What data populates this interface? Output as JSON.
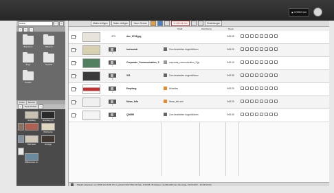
{
  "header": {
    "preview_label": "VORSCHAU"
  },
  "sidebar": {
    "search_value": "Global",
    "folders": [
      {
        "label": "Branchen"
      },
      {
        "label": "Dänisch"
      },
      {
        "label": "Engl."
      },
      {
        "label": "Technik"
      },
      {
        "label": "Kreativ"
      }
    ],
    "tabs": [
      "Listen",
      "Bereich"
    ],
    "media_search_label": "Neue Ordner",
    "thumbs": [
      {
        "label": "Empfang",
        "color": "#c8c0b0"
      },
      {
        "label": "Empfang (1)",
        "color": "#2a2a2a"
      },
      {
        "label": "",
        "color": "#8a7060"
      },
      {
        "label": "Wahlweise",
        "color": "#e0d8c0"
      },
      {
        "label": "",
        "color": "#b06050"
      },
      {
        "label": "",
        "color": "#8090a0"
      },
      {
        "label": "Bild Seite",
        "color": "#d0c8b8"
      },
      {
        "label": "Anzeige",
        "color": "#403830"
      },
      {
        "label": "",
        "color": "#e8e8e8"
      },
      {
        "label": "Willkommen im Haus",
        "color": "#6a8aa0"
      }
    ]
  },
  "toolbar": {
    "insert_media": "Media einfügen",
    "insert_data": "Daten einfügen",
    "new_screen": "Neuer Screen",
    "publish": "Veröffentlichen",
    "settings": "Einstellungen"
  },
  "columns": {
    "inhalt": "Inhalt",
    "zuordnung": "Zuordnung",
    "dauer": "Dauer"
  },
  "rows": [
    {
      "num": "1",
      "typ": "JPG",
      "size": "1",
      "name": "doc_6748.jpg",
      "inhalt": "",
      "dauer": "0:00:05",
      "thumb": "#e8e4dc",
      "inhalt_icon": "none"
    },
    {
      "num": "2",
      "typ": "",
      "size": "1",
      "name": "horizontal",
      "inhalt": "Zum bearbeiten doppelklicken",
      "dauer": "0:00:20",
      "thumb": "#d8d0b0",
      "inhalt_icon": "dark"
    },
    {
      "num": "3",
      "typ": "",
      "size": "1",
      "name": "Corporate_Communication_3",
      "inhalt": "corporate_communication_3.jpg",
      "dauer": "0:00:10",
      "thumb": "#508060",
      "inhalt_icon": "dark"
    },
    {
      "num": "4",
      "typ": "",
      "size": "1",
      "name": "321",
      "inhalt": "Zum bearbeiten doppelklicken",
      "dauer": "0:00:30",
      "thumb": "#3a3a3a",
      "inhalt_icon": "dark"
    },
    {
      "num": "5",
      "typ": "",
      "size": "1",
      "name": "Empfang",
      "inhalt": "Aktuelles",
      "dauer": "0:00:20",
      "thumb": "#c03030",
      "inhalt_icon": "orange"
    },
    {
      "num": "6",
      "typ": "",
      "size": "1",
      "name": "News_Info",
      "inhalt": "News_info.xml",
      "dauer": "0:00:20",
      "thumb": "#f0f0f0",
      "inhalt_icon": "orange"
    },
    {
      "num": "7",
      "typ": "",
      "size": "1",
      "name": "QDMW",
      "inhalt": "Zum bearbeiten doppelklicken",
      "dauer": "0:00:30",
      "thumb": "#f4f4f4",
      "inhalt_icon": "dark"
    }
  ],
  "status": {
    "text": "Playlist abspielen von 08:00 bis 00:00 Uhr, Laufzeit 0 Std 5 Min 09 Sek, 4:09 KB, 35 Dateien, Veröffentlicht am Dienstag, 19.09.2017 - 13:23:46 Uhr"
  },
  "colors": {
    "accent": "#cc3333",
    "topbar": "#2b2b2b",
    "sidebar": "#5a5a5a"
  }
}
